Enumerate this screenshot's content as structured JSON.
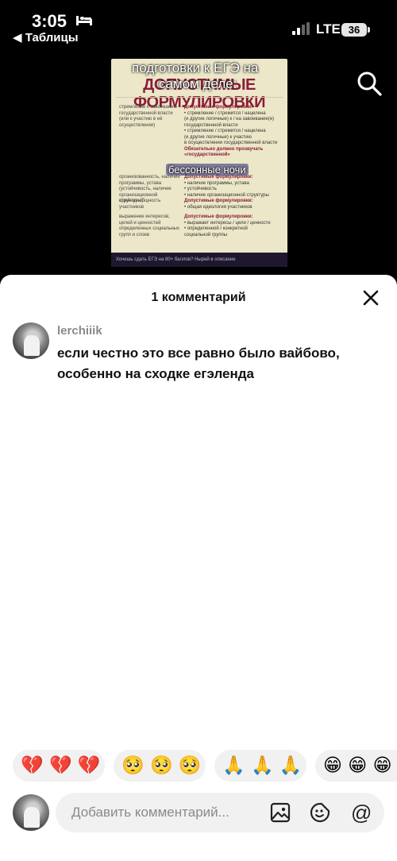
{
  "status_bar": {
    "time": "3:05",
    "back_label": "◀ Таблицы",
    "network": "LTE",
    "battery": "36"
  },
  "video": {
    "slide_title": "ДОПУСТИМЫЕ ФОРМУЛИРОВКИ",
    "captions": [
      "подготовки к ЕГЭ на",
      "самом деле:",
      "бессонные ночи"
    ],
    "slide_footer": "Хочешь сдать ЕГЭ на 80+ баллов? Нырей в описание"
  },
  "sheet": {
    "title": "1 комментарий",
    "comment": {
      "username": "lerchiiik",
      "text": "если честно это все равно было вайбово, особенно на сходке егэленда"
    }
  },
  "emoji_bar": [
    {
      "emojis": "💔 💔 💔"
    },
    {
      "emojis": "🥺 🥺 🥺"
    },
    {
      "emojis": "🙏 🙏 🙏"
    },
    {
      "emojis": "😁 😁 😁"
    }
  ],
  "composer": {
    "placeholder": "Добавить комментарий...",
    "at_symbol": "@"
  }
}
